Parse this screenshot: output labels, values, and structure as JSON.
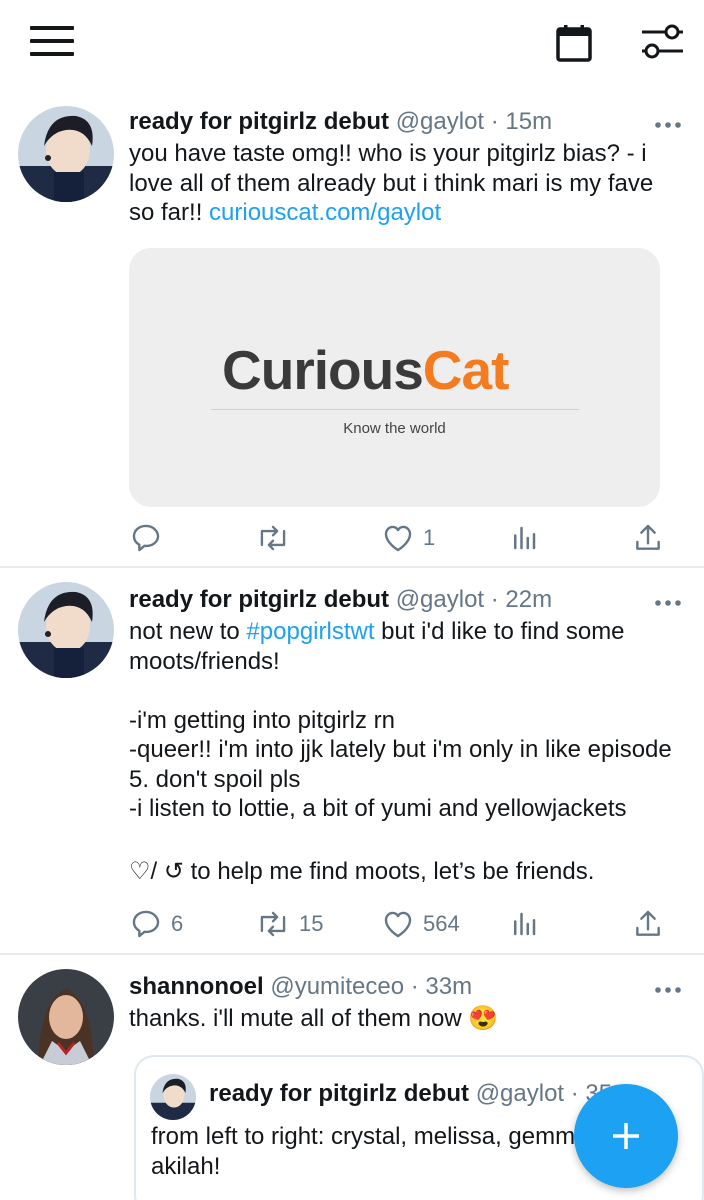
{
  "header": {
    "menu_icon": "hamburger-menu-icon",
    "calendar_icon": "calendar-icon",
    "filter_icon": "sliders-icon"
  },
  "tweets": [
    {
      "name": "ready for pitgirlz debut",
      "handle": "@gaylot",
      "time": "· 15m",
      "text": "you have taste omg!! who is your pitgirlz bias? - i love all of them already but i think mari is my fave so far!!",
      "link": "curiouscat.com/gaylot",
      "card": {
        "logo_part1": "Curious",
        "logo_part2": "Cat",
        "tagline": "Know the world",
        "accent": "#f47b1e"
      },
      "replies": "",
      "retweets": "",
      "likes": "1"
    },
    {
      "name": "ready for pitgirlz debut",
      "handle": "@gaylot",
      "time": "· 22m",
      "text_before": "not new to ",
      "hashtag": "#popgirlstwt",
      "text_after": " but i'd like to find some moots/friends!",
      "line1": "-i'm getting into pitgirlz rn",
      "line2": "-queer!! i'm into jjk lately but i'm only in like episode 5. don't spoil pls",
      "line3": "-i listen to lottie, a bit of yumi and yellowjackets",
      "line4": "♡/ ↺  to help me find moots, let’s be friends.",
      "replies": "6",
      "retweets": "15",
      "likes": "564"
    },
    {
      "name": "shannonoel",
      "handle": "@yumiteceo",
      "time": "· 33m",
      "text": "thanks. i'll mute all of them now 😍",
      "quote": {
        "name": "ready for pitgirlz debut",
        "handle": "@gaylot",
        "time": "· 35m",
        "text": "from left to right: crystal, melissa, gemma and akilah!"
      }
    }
  ],
  "colors": {
    "link": "#1da1f2",
    "muted": "#657786",
    "fab": "#1da1f2"
  },
  "fab_icon": "plus-icon"
}
